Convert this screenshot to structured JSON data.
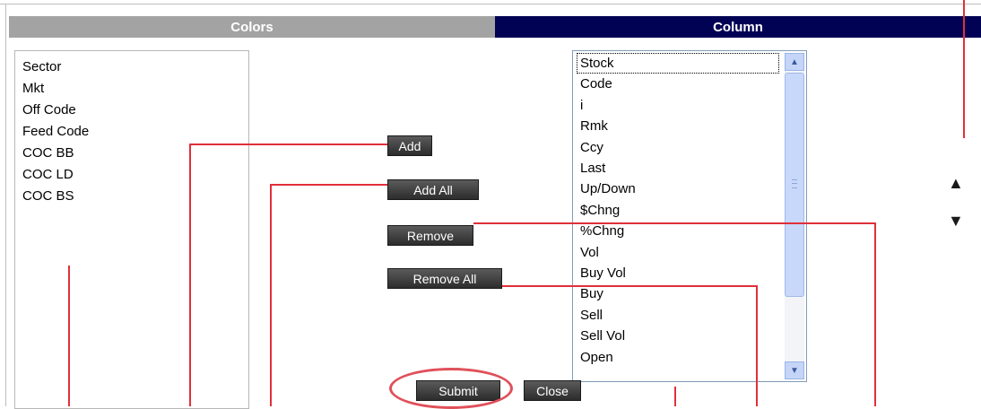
{
  "tabs": {
    "colors": "Colors",
    "column": "Column"
  },
  "available_columns": [
    "Sector",
    "Mkt",
    "Off Code",
    "Feed Code",
    "COC BB",
    "COC LD",
    "COC BS"
  ],
  "selected_columns": [
    "Stock",
    "Code",
    "i",
    "Rmk",
    "Ccy",
    "Last",
    "Up/Down",
    "$Chng",
    "%Chng",
    "Vol",
    "Buy Vol",
    "Buy",
    "Sell",
    "Sell Vol",
    "Open"
  ],
  "buttons": {
    "add": "Add",
    "add_all": "Add All",
    "remove": "Remove",
    "remove_all": "Remove All",
    "submit": "Submit",
    "close": "Close"
  },
  "icons": {
    "move_up": "▲",
    "move_down": "▼",
    "scroll_up": "▲",
    "scroll_down": "▼"
  },
  "colors": {
    "colors_tab_bg": "#a3a3a3",
    "column_tab_bg": "#020255",
    "annotation": "#e0303a"
  }
}
